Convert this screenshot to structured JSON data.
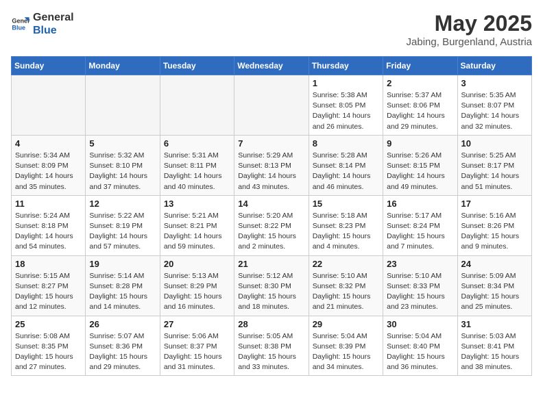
{
  "logo": {
    "line1": "General",
    "line2": "Blue"
  },
  "title": "May 2025",
  "location": "Jabing, Burgenland, Austria",
  "days_of_week": [
    "Sunday",
    "Monday",
    "Tuesday",
    "Wednesday",
    "Thursday",
    "Friday",
    "Saturday"
  ],
  "weeks": [
    [
      {
        "day": "",
        "info": ""
      },
      {
        "day": "",
        "info": ""
      },
      {
        "day": "",
        "info": ""
      },
      {
        "day": "",
        "info": ""
      },
      {
        "day": "1",
        "info": "Sunrise: 5:38 AM\nSunset: 8:05 PM\nDaylight: 14 hours\nand 26 minutes."
      },
      {
        "day": "2",
        "info": "Sunrise: 5:37 AM\nSunset: 8:06 PM\nDaylight: 14 hours\nand 29 minutes."
      },
      {
        "day": "3",
        "info": "Sunrise: 5:35 AM\nSunset: 8:07 PM\nDaylight: 14 hours\nand 32 minutes."
      }
    ],
    [
      {
        "day": "4",
        "info": "Sunrise: 5:34 AM\nSunset: 8:09 PM\nDaylight: 14 hours\nand 35 minutes."
      },
      {
        "day": "5",
        "info": "Sunrise: 5:32 AM\nSunset: 8:10 PM\nDaylight: 14 hours\nand 37 minutes."
      },
      {
        "day": "6",
        "info": "Sunrise: 5:31 AM\nSunset: 8:11 PM\nDaylight: 14 hours\nand 40 minutes."
      },
      {
        "day": "7",
        "info": "Sunrise: 5:29 AM\nSunset: 8:13 PM\nDaylight: 14 hours\nand 43 minutes."
      },
      {
        "day": "8",
        "info": "Sunrise: 5:28 AM\nSunset: 8:14 PM\nDaylight: 14 hours\nand 46 minutes."
      },
      {
        "day": "9",
        "info": "Sunrise: 5:26 AM\nSunset: 8:15 PM\nDaylight: 14 hours\nand 49 minutes."
      },
      {
        "day": "10",
        "info": "Sunrise: 5:25 AM\nSunset: 8:17 PM\nDaylight: 14 hours\nand 51 minutes."
      }
    ],
    [
      {
        "day": "11",
        "info": "Sunrise: 5:24 AM\nSunset: 8:18 PM\nDaylight: 14 hours\nand 54 minutes."
      },
      {
        "day": "12",
        "info": "Sunrise: 5:22 AM\nSunset: 8:19 PM\nDaylight: 14 hours\nand 57 minutes."
      },
      {
        "day": "13",
        "info": "Sunrise: 5:21 AM\nSunset: 8:21 PM\nDaylight: 14 hours\nand 59 minutes."
      },
      {
        "day": "14",
        "info": "Sunrise: 5:20 AM\nSunset: 8:22 PM\nDaylight: 15 hours\nand 2 minutes."
      },
      {
        "day": "15",
        "info": "Sunrise: 5:18 AM\nSunset: 8:23 PM\nDaylight: 15 hours\nand 4 minutes."
      },
      {
        "day": "16",
        "info": "Sunrise: 5:17 AM\nSunset: 8:24 PM\nDaylight: 15 hours\nand 7 minutes."
      },
      {
        "day": "17",
        "info": "Sunrise: 5:16 AM\nSunset: 8:26 PM\nDaylight: 15 hours\nand 9 minutes."
      }
    ],
    [
      {
        "day": "18",
        "info": "Sunrise: 5:15 AM\nSunset: 8:27 PM\nDaylight: 15 hours\nand 12 minutes."
      },
      {
        "day": "19",
        "info": "Sunrise: 5:14 AM\nSunset: 8:28 PM\nDaylight: 15 hours\nand 14 minutes."
      },
      {
        "day": "20",
        "info": "Sunrise: 5:13 AM\nSunset: 8:29 PM\nDaylight: 15 hours\nand 16 minutes."
      },
      {
        "day": "21",
        "info": "Sunrise: 5:12 AM\nSunset: 8:30 PM\nDaylight: 15 hours\nand 18 minutes."
      },
      {
        "day": "22",
        "info": "Sunrise: 5:10 AM\nSunset: 8:32 PM\nDaylight: 15 hours\nand 21 minutes."
      },
      {
        "day": "23",
        "info": "Sunrise: 5:10 AM\nSunset: 8:33 PM\nDaylight: 15 hours\nand 23 minutes."
      },
      {
        "day": "24",
        "info": "Sunrise: 5:09 AM\nSunset: 8:34 PM\nDaylight: 15 hours\nand 25 minutes."
      }
    ],
    [
      {
        "day": "25",
        "info": "Sunrise: 5:08 AM\nSunset: 8:35 PM\nDaylight: 15 hours\nand 27 minutes."
      },
      {
        "day": "26",
        "info": "Sunrise: 5:07 AM\nSunset: 8:36 PM\nDaylight: 15 hours\nand 29 minutes."
      },
      {
        "day": "27",
        "info": "Sunrise: 5:06 AM\nSunset: 8:37 PM\nDaylight: 15 hours\nand 31 minutes."
      },
      {
        "day": "28",
        "info": "Sunrise: 5:05 AM\nSunset: 8:38 PM\nDaylight: 15 hours\nand 33 minutes."
      },
      {
        "day": "29",
        "info": "Sunrise: 5:04 AM\nSunset: 8:39 PM\nDaylight: 15 hours\nand 34 minutes."
      },
      {
        "day": "30",
        "info": "Sunrise: 5:04 AM\nSunset: 8:40 PM\nDaylight: 15 hours\nand 36 minutes."
      },
      {
        "day": "31",
        "info": "Sunrise: 5:03 AM\nSunset: 8:41 PM\nDaylight: 15 hours\nand 38 minutes."
      }
    ]
  ]
}
